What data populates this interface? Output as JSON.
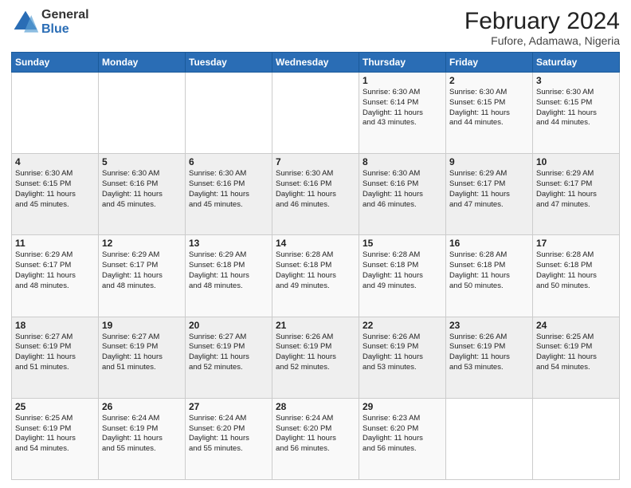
{
  "header": {
    "logo_general": "General",
    "logo_blue": "Blue",
    "month_year": "February 2024",
    "location": "Fufore, Adamawa, Nigeria"
  },
  "days_of_week": [
    "Sunday",
    "Monday",
    "Tuesday",
    "Wednesday",
    "Thursday",
    "Friday",
    "Saturday"
  ],
  "weeks": [
    [
      {
        "day": "",
        "info": ""
      },
      {
        "day": "",
        "info": ""
      },
      {
        "day": "",
        "info": ""
      },
      {
        "day": "",
        "info": ""
      },
      {
        "day": "1",
        "info": "Sunrise: 6:30 AM\nSunset: 6:14 PM\nDaylight: 11 hours\nand 43 minutes."
      },
      {
        "day": "2",
        "info": "Sunrise: 6:30 AM\nSunset: 6:15 PM\nDaylight: 11 hours\nand 44 minutes."
      },
      {
        "day": "3",
        "info": "Sunrise: 6:30 AM\nSunset: 6:15 PM\nDaylight: 11 hours\nand 44 minutes."
      }
    ],
    [
      {
        "day": "4",
        "info": "Sunrise: 6:30 AM\nSunset: 6:15 PM\nDaylight: 11 hours\nand 45 minutes."
      },
      {
        "day": "5",
        "info": "Sunrise: 6:30 AM\nSunset: 6:16 PM\nDaylight: 11 hours\nand 45 minutes."
      },
      {
        "day": "6",
        "info": "Sunrise: 6:30 AM\nSunset: 6:16 PM\nDaylight: 11 hours\nand 45 minutes."
      },
      {
        "day": "7",
        "info": "Sunrise: 6:30 AM\nSunset: 6:16 PM\nDaylight: 11 hours\nand 46 minutes."
      },
      {
        "day": "8",
        "info": "Sunrise: 6:30 AM\nSunset: 6:16 PM\nDaylight: 11 hours\nand 46 minutes."
      },
      {
        "day": "9",
        "info": "Sunrise: 6:29 AM\nSunset: 6:17 PM\nDaylight: 11 hours\nand 47 minutes."
      },
      {
        "day": "10",
        "info": "Sunrise: 6:29 AM\nSunset: 6:17 PM\nDaylight: 11 hours\nand 47 minutes."
      }
    ],
    [
      {
        "day": "11",
        "info": "Sunrise: 6:29 AM\nSunset: 6:17 PM\nDaylight: 11 hours\nand 48 minutes."
      },
      {
        "day": "12",
        "info": "Sunrise: 6:29 AM\nSunset: 6:17 PM\nDaylight: 11 hours\nand 48 minutes."
      },
      {
        "day": "13",
        "info": "Sunrise: 6:29 AM\nSunset: 6:18 PM\nDaylight: 11 hours\nand 48 minutes."
      },
      {
        "day": "14",
        "info": "Sunrise: 6:28 AM\nSunset: 6:18 PM\nDaylight: 11 hours\nand 49 minutes."
      },
      {
        "day": "15",
        "info": "Sunrise: 6:28 AM\nSunset: 6:18 PM\nDaylight: 11 hours\nand 49 minutes."
      },
      {
        "day": "16",
        "info": "Sunrise: 6:28 AM\nSunset: 6:18 PM\nDaylight: 11 hours\nand 50 minutes."
      },
      {
        "day": "17",
        "info": "Sunrise: 6:28 AM\nSunset: 6:18 PM\nDaylight: 11 hours\nand 50 minutes."
      }
    ],
    [
      {
        "day": "18",
        "info": "Sunrise: 6:27 AM\nSunset: 6:19 PM\nDaylight: 11 hours\nand 51 minutes."
      },
      {
        "day": "19",
        "info": "Sunrise: 6:27 AM\nSunset: 6:19 PM\nDaylight: 11 hours\nand 51 minutes."
      },
      {
        "day": "20",
        "info": "Sunrise: 6:27 AM\nSunset: 6:19 PM\nDaylight: 11 hours\nand 52 minutes."
      },
      {
        "day": "21",
        "info": "Sunrise: 6:26 AM\nSunset: 6:19 PM\nDaylight: 11 hours\nand 52 minutes."
      },
      {
        "day": "22",
        "info": "Sunrise: 6:26 AM\nSunset: 6:19 PM\nDaylight: 11 hours\nand 53 minutes."
      },
      {
        "day": "23",
        "info": "Sunrise: 6:26 AM\nSunset: 6:19 PM\nDaylight: 11 hours\nand 53 minutes."
      },
      {
        "day": "24",
        "info": "Sunrise: 6:25 AM\nSunset: 6:19 PM\nDaylight: 11 hours\nand 54 minutes."
      }
    ],
    [
      {
        "day": "25",
        "info": "Sunrise: 6:25 AM\nSunset: 6:19 PM\nDaylight: 11 hours\nand 54 minutes."
      },
      {
        "day": "26",
        "info": "Sunrise: 6:24 AM\nSunset: 6:19 PM\nDaylight: 11 hours\nand 55 minutes."
      },
      {
        "day": "27",
        "info": "Sunrise: 6:24 AM\nSunset: 6:20 PM\nDaylight: 11 hours\nand 55 minutes."
      },
      {
        "day": "28",
        "info": "Sunrise: 6:24 AM\nSunset: 6:20 PM\nDaylight: 11 hours\nand 56 minutes."
      },
      {
        "day": "29",
        "info": "Sunrise: 6:23 AM\nSunset: 6:20 PM\nDaylight: 11 hours\nand 56 minutes."
      },
      {
        "day": "",
        "info": ""
      },
      {
        "day": "",
        "info": ""
      }
    ]
  ]
}
